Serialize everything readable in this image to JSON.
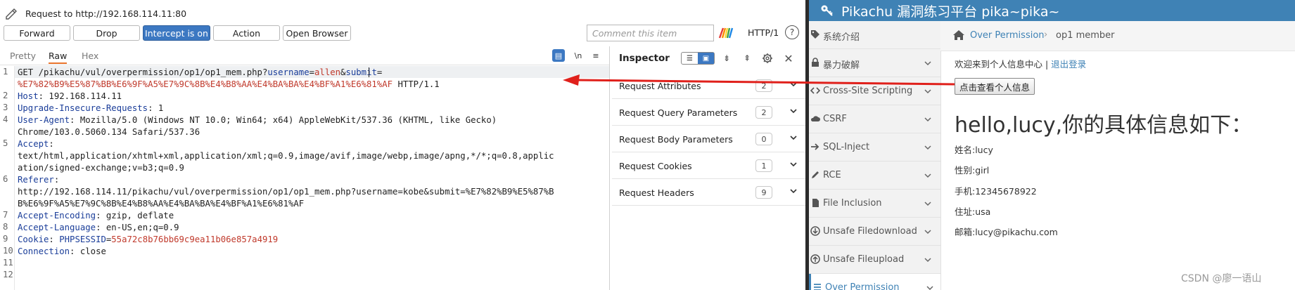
{
  "burp": {
    "request_title": "Request to http://192.168.114.11:80",
    "buttons": {
      "forward": "Forward",
      "drop": "Drop",
      "intercept": "Intercept is on",
      "action": "Action",
      "open_browser": "Open Browser"
    },
    "comment_placeholder": "Comment this item",
    "http_version": "HTTP/1",
    "help": "?",
    "tabs": [
      "Pretty",
      "Raw",
      "Hex"
    ],
    "active_tab": "Raw",
    "newline_toggle": "\\n",
    "menu_icon": "≡",
    "line_numbers": [
      "1",
      "2",
      "3",
      "4",
      "5",
      "6",
      "7",
      "8",
      "9",
      "10",
      "11",
      "12"
    ],
    "request": {
      "l1_method_path": "GET /pikachu/vul/overpermission/op1/op1_mem.php?",
      "l1_key1": "username",
      "l1_eq1": "=",
      "l1_val1": "allen",
      "l1_amp": "&",
      "l1_key2": "submit",
      "l1_eq2": "=",
      "l1_val2": "%E7%82%B9%E5%87%BB%E6%9F%A5%E7%9C%8B%E4%B8%AA%E4%BA%BA%E4%BF%A1%E6%81%AF",
      "l1_proto": " HTTP/1.1",
      "l2_key": "Host",
      "l2_val": ": 192.168.114.11",
      "l3_key": "Upgrade-Insecure-Requests",
      "l3_val": ": 1",
      "l4_key": "User-Agent",
      "l4_val": ": Mozilla/5.0 (Windows NT 10.0; Win64; x64) AppleWebKit/537.36 (KHTML, like Gecko)",
      "l4_cont": "Chrome/103.0.5060.134 Safari/537.36",
      "l5_key": "Accept",
      "l5_val": ":",
      "l5_cont1": "text/html,application/xhtml+xml,application/xml;q=0.9,image/avif,image/webp,image/apng,*/*;q=0.8,applic",
      "l5_cont2": "ation/signed-exchange;v=b3;q=0.9",
      "l6_key": "Referer",
      "l6_val": ":",
      "l6_cont1": "http://192.168.114.11/pikachu/vul/overpermission/op1/op1_mem.php?username=kobe&submit=%E7%82%B9%E5%87%B",
      "l6_cont2": "B%E6%9F%A5%E7%9C%8B%E4%B8%AA%E4%BA%BA%E4%BF%A1%E6%81%AF",
      "l7_key": "Accept-Encoding",
      "l7_val": ": gzip, deflate",
      "l8_key": "Accept-Language",
      "l8_val": ": en-US,en;q=0.9",
      "l9_key": "Cookie",
      "l9_sep": ": ",
      "l9_ckey": "PHPSESSID",
      "l9_eq": "=",
      "l9_cval": "55a72c8b76bb69c9ea11b06e857a4919",
      "l10_key": "Connection",
      "l10_val": ": close"
    },
    "inspector": {
      "title": "Inspector",
      "sections": [
        {
          "label": "Request Attributes",
          "count": "2"
        },
        {
          "label": "Request Query Parameters",
          "count": "2"
        },
        {
          "label": "Request Body Parameters",
          "count": "0"
        },
        {
          "label": "Request Cookies",
          "count": "1"
        },
        {
          "label": "Request Headers",
          "count": "9"
        }
      ]
    }
  },
  "pikachu": {
    "header_title": "Pikachu 漏洞练习平台 pika~pika~",
    "sidebar": [
      {
        "label": "系统介绍",
        "icon": "tag-icon",
        "has_chevron": false
      },
      {
        "label": "暴力破解",
        "icon": "lock-icon",
        "has_chevron": true
      },
      {
        "label": "Cross-Site Scripting",
        "icon": "code-icon",
        "has_chevron": true
      },
      {
        "label": "CSRF",
        "icon": "cloud-icon",
        "has_chevron": true
      },
      {
        "label": "SQL-Inject",
        "icon": "arrow-right-icon",
        "has_chevron": true
      },
      {
        "label": "RCE",
        "icon": "pencil-icon",
        "has_chevron": true
      },
      {
        "label": "File Inclusion",
        "icon": "file-icon",
        "has_chevron": true
      },
      {
        "label": "Unsafe Filedownload",
        "icon": "download-icon",
        "has_chevron": true
      },
      {
        "label": "Unsafe Fileupload",
        "icon": "upload-icon",
        "has_chevron": true
      },
      {
        "label": "Over Permission",
        "icon": "list-icon",
        "has_chevron": true
      }
    ],
    "breadcrumb": {
      "section": "Over Permission",
      "separator": "›",
      "current": "op1 member"
    },
    "welcome_text": "欢迎来到个人信息中心 | ",
    "logout": "退出登录",
    "view_button": "点击查看个人信息",
    "hello": "hello,lucy,你的具体信息如下：",
    "info": [
      "姓名:lucy",
      "性别:girl",
      "手机:12345678922",
      "住址:usa",
      "邮箱:lucy@pikachu.com"
    ]
  },
  "watermark": "CSDN @廖一语山",
  "colors": {
    "accent": "#3f82b5",
    "intercept": "#3c78c2",
    "param_key": "#1a3d99",
    "param_value": "#c0392b",
    "arrow": "#e0201b"
  }
}
